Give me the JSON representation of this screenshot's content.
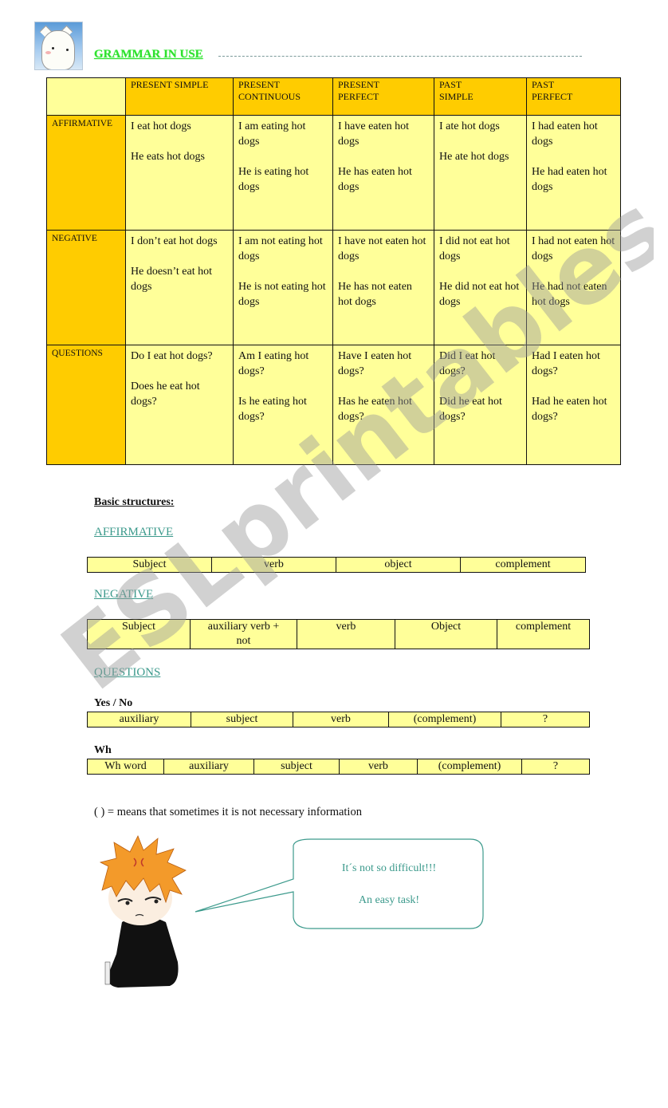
{
  "header": {
    "title": "GRAMMAR IN USE",
    "logo_icon": "cartoon-face-icon"
  },
  "grammar_table": {
    "columns": [
      "PRESENT SIMPLE",
      "PRESENT CONTINUOUS",
      "PRESENT PERFECT",
      "PAST SIMPLE",
      "PAST PERFECT"
    ],
    "columns_lines": [
      [
        "PRESENT SIMPLE"
      ],
      [
        "PRESENT",
        "CONTINUOUS"
      ],
      [
        "PRESENT",
        "PERFECT"
      ],
      [
        "PAST",
        "SIMPLE"
      ],
      [
        "PAST",
        "PERFECT"
      ]
    ],
    "rows": [
      {
        "label": "AFFIRMATIVE",
        "cells": [
          [
            "I eat hot dogs",
            "He eats hot dogs"
          ],
          [
            "I am eating hot dogs",
            "He is eating hot dogs"
          ],
          [
            "I have eaten hot dogs",
            "He has eaten hot dogs"
          ],
          [
            "I ate hot dogs",
            "He ate hot dogs"
          ],
          [
            "I had eaten hot dogs",
            "He had eaten hot dogs"
          ]
        ]
      },
      {
        "label": "NEGATIVE",
        "cells": [
          [
            "I don’t eat hot dogs",
            "He doesn’t eat hot dogs"
          ],
          [
            "I am not eating hot dogs",
            "He is not eating hot dogs"
          ],
          [
            "I have not eaten hot dogs",
            "He has not eaten hot dogs"
          ],
          [
            "I did not eat hot dogs",
            "He did not eat hot dogs"
          ],
          [
            "I had not eaten hot dogs",
            "He had not eaten hot dogs"
          ]
        ]
      },
      {
        "label": "QUESTIONS",
        "cells": [
          [
            "Do I eat hot dogs?",
            "Does he eat hot dogs?"
          ],
          [
            "Am I eating hot dogs?",
            "Is he eating hot dogs?"
          ],
          [
            "Have I eaten hot dogs?",
            "Has he eaten hot dogs?"
          ],
          [
            "Did I eat hot dogs?",
            "Did he eat hot dogs?"
          ],
          [
            "Had I eaten hot dogs?",
            "Had he eaten hot dogs?"
          ]
        ]
      }
    ]
  },
  "basic_structures": {
    "title": "Basic structures:",
    "affirmative": {
      "label": "AFFIRMATIVE",
      "cells": [
        "Subject",
        "verb",
        "object",
        "complement"
      ]
    },
    "negative": {
      "label": "NEGATIVE",
      "cells": [
        "Subject",
        "auxiliary verb + not",
        "verb",
        "Object",
        "complement"
      ]
    },
    "questions": {
      "label": "QUESTIONS",
      "yes_no": {
        "label": "Yes / No",
        "cells": [
          "auxiliary",
          "subject",
          "verb",
          "(complement)",
          "?"
        ]
      },
      "wh": {
        "label": "Wh",
        "cells": [
          "Wh word",
          "auxiliary",
          "subject",
          "verb",
          "(complement)",
          "?"
        ]
      }
    },
    "note": "( ) = means that sometimes it is not necessary information"
  },
  "speech_bubble": {
    "line1": "It´s not so difficult!!!",
    "line2": "An easy task!"
  },
  "watermark": "ESLprintables.com",
  "colors": {
    "header_orange": "#ffcc00",
    "cell_yellow": "#ffff99",
    "title_green": "#2ee02e",
    "section_teal": "#3c9a8c"
  }
}
